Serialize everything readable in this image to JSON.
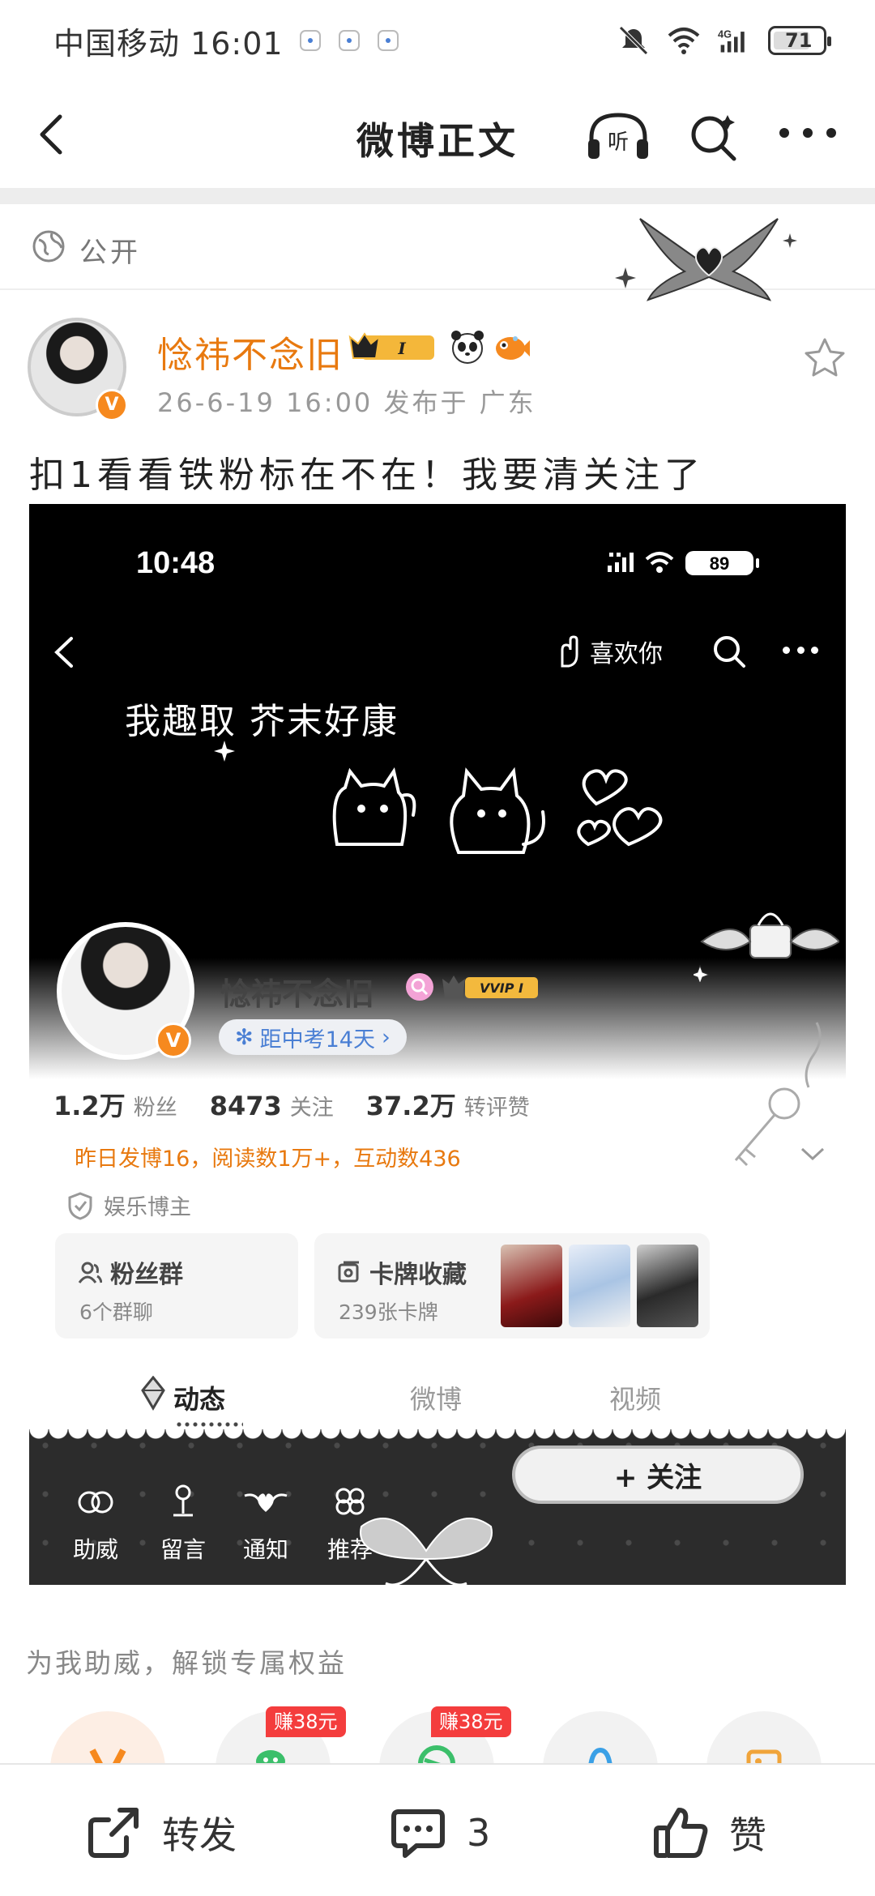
{
  "status_bar": {
    "carrier_time": "中国移动 16:01",
    "battery": "71"
  },
  "nav": {
    "title": "微博正文",
    "listen_label": "听"
  },
  "visibility": {
    "label": "公开"
  },
  "author": {
    "name": "惗祎不念旧",
    "verified_mark": "V",
    "meta": "26-6-19 16:00  发布于 广东",
    "member_badge": "I"
  },
  "post": {
    "text": "扣1看看铁粉标在不在！我要清关注了"
  },
  "embedded": {
    "time": "10:48",
    "battery": "89",
    "like_label": "喜欢你",
    "handwriting": "我趣取 芥末好康",
    "profile_name": "惗祎不念旧",
    "vvip_badge": "VVIP I",
    "countdown": "距中考14天",
    "stats": [
      {
        "num": "1.2万",
        "label": "粉丝"
      },
      {
        "num": "8473",
        "label": "关注"
      },
      {
        "num": "37.2万",
        "label": "转评赞"
      }
    ],
    "activity": "昨日发博16，阅读数1万+，互动数436",
    "role": "娱乐博主",
    "fans_card": {
      "title": "粉丝群",
      "sub": "6个群聊"
    },
    "cards_card": {
      "title": "卡牌收藏",
      "sub": "239张卡牌"
    },
    "tabs": [
      "动态",
      "微博",
      "视频"
    ],
    "banner_nav": [
      "助威",
      "留言",
      "通知",
      "推荐"
    ],
    "follow_label": "+ 关注"
  },
  "boost": {
    "text": "为我助威，解锁专属权益",
    "earn_tags": [
      "赚38元",
      "赚38元"
    ]
  },
  "actions": {
    "repost": "转发",
    "comment_count": "3",
    "like": "赞"
  },
  "colors": {
    "accent_orange": "#e8790f",
    "verify_orange": "#f6891e",
    "link_blue": "#4a7fd4",
    "earn_red": "#f43d3d"
  }
}
